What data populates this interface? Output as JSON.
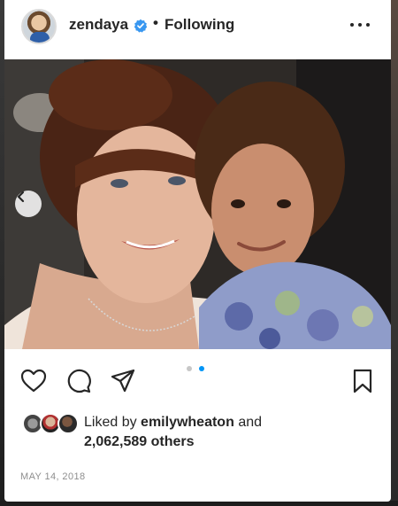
{
  "post": {
    "username": "zendaya",
    "separator": "•",
    "follow_status": "Following",
    "more_icon": "more-options-icon",
    "verified_color": "#3897f0",
    "photo_alt_content": "photo",
    "carousel": {
      "current_index": 1,
      "total": 2,
      "active_color": "#0095f6",
      "inactive_color": "#c7c7c7"
    },
    "likes": {
      "prefix": "Liked by",
      "liker": "emilywheaton",
      "conjunction": "and",
      "others": "2,062,589 others"
    },
    "date": "MAY 14, 2018"
  }
}
